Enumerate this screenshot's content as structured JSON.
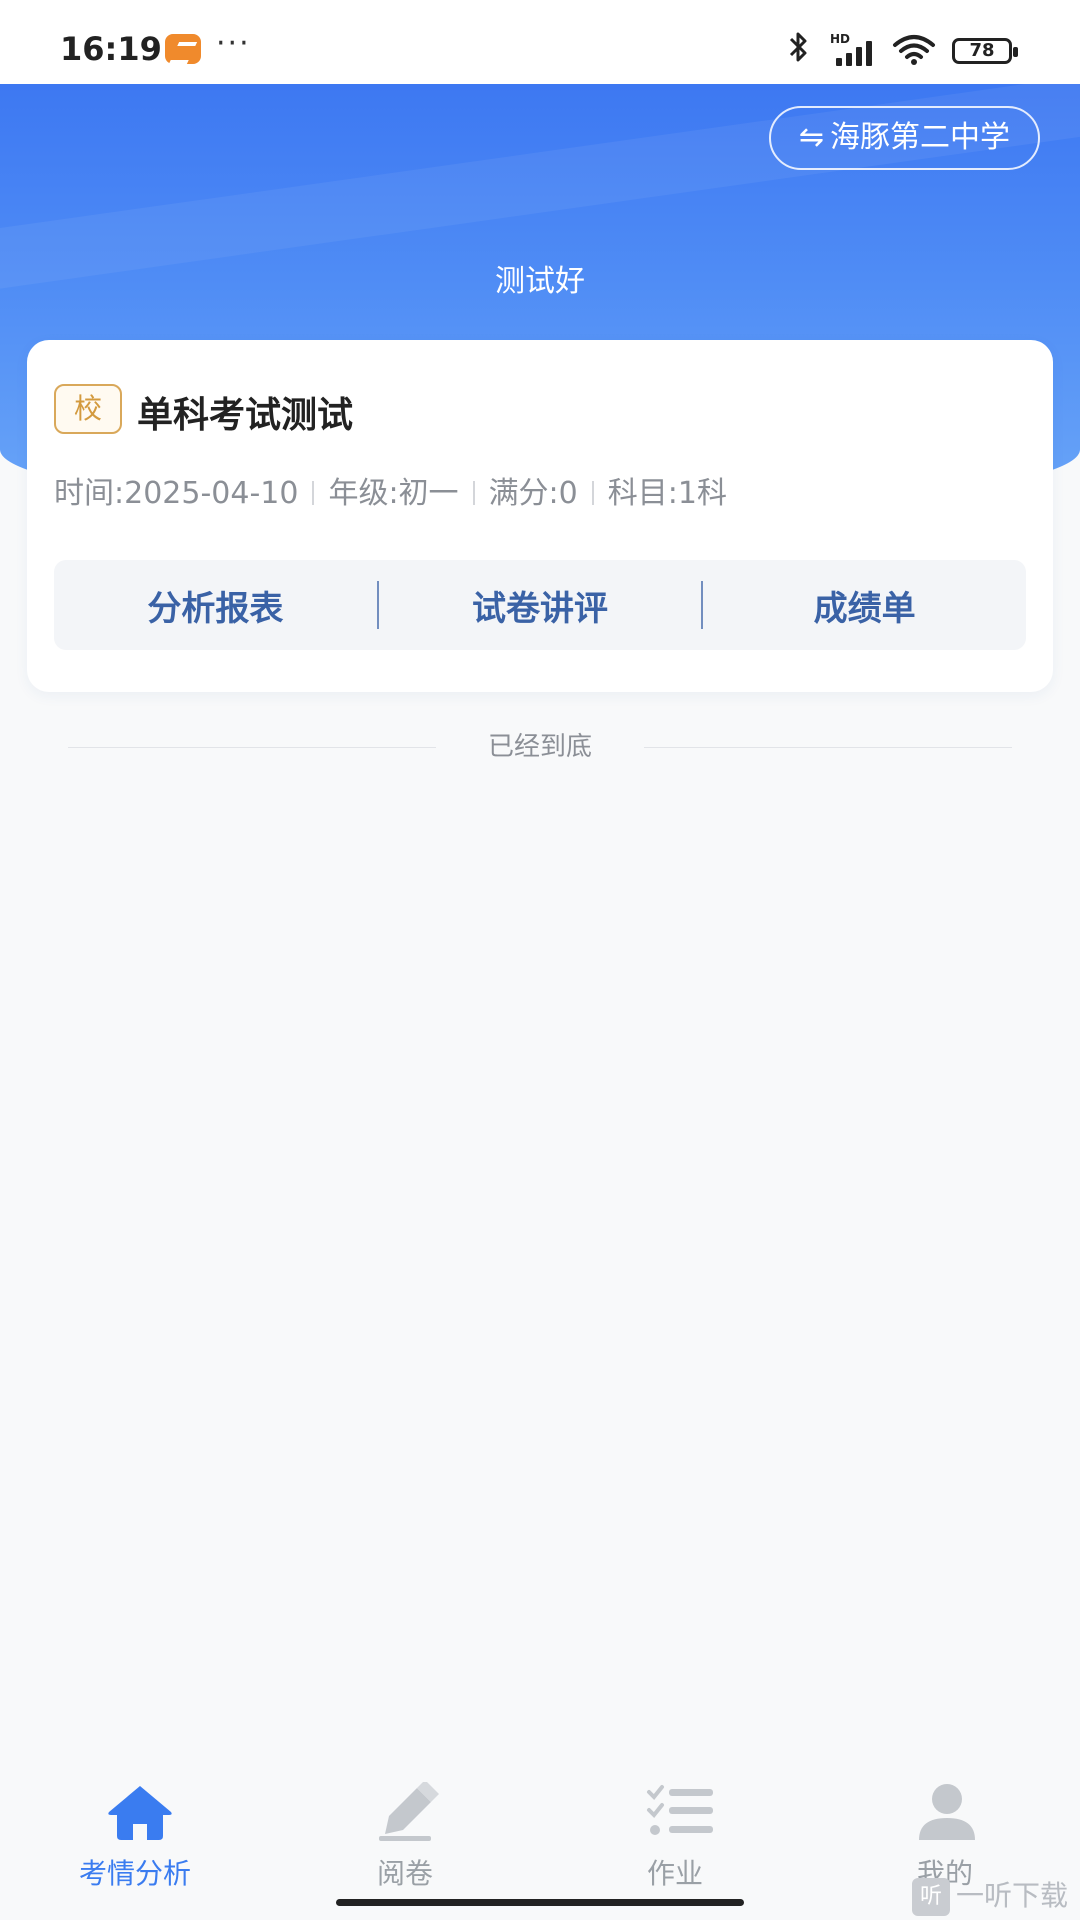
{
  "status_bar": {
    "time": "16:19",
    "more": "···",
    "signal_tag": "HD",
    "battery": "78"
  },
  "header": {
    "school_switch_icon": "⇋",
    "school_name": "海豚第二中学",
    "title": "测试好"
  },
  "exam_card": {
    "badge": "校",
    "title": "单科考试测试",
    "meta": {
      "time": "时间:2025-04-10",
      "grade": "年级:初一",
      "full_score": "满分:0",
      "subjects": "科目:1科"
    },
    "actions": {
      "analysis_report": "分析报表",
      "paper_review": "试卷讲评",
      "score_sheet": "成绩单"
    }
  },
  "list_end": "已经到底",
  "bottom_nav": {
    "items": [
      {
        "label": "考情分析",
        "icon": "home-icon",
        "active": true
      },
      {
        "label": "阅卷",
        "icon": "pen-icon",
        "active": false
      },
      {
        "label": "作业",
        "icon": "checklist-icon",
        "active": false
      },
      {
        "label": "我的",
        "icon": "user-icon",
        "active": false
      }
    ]
  },
  "colors": {
    "primary": "#3a7cf0",
    "action_text": "#3a62a6",
    "badge": "#d39a3e",
    "inactive": "#9aa0a6"
  },
  "watermark": {
    "icon_char": "听",
    "text": "一听下载"
  }
}
